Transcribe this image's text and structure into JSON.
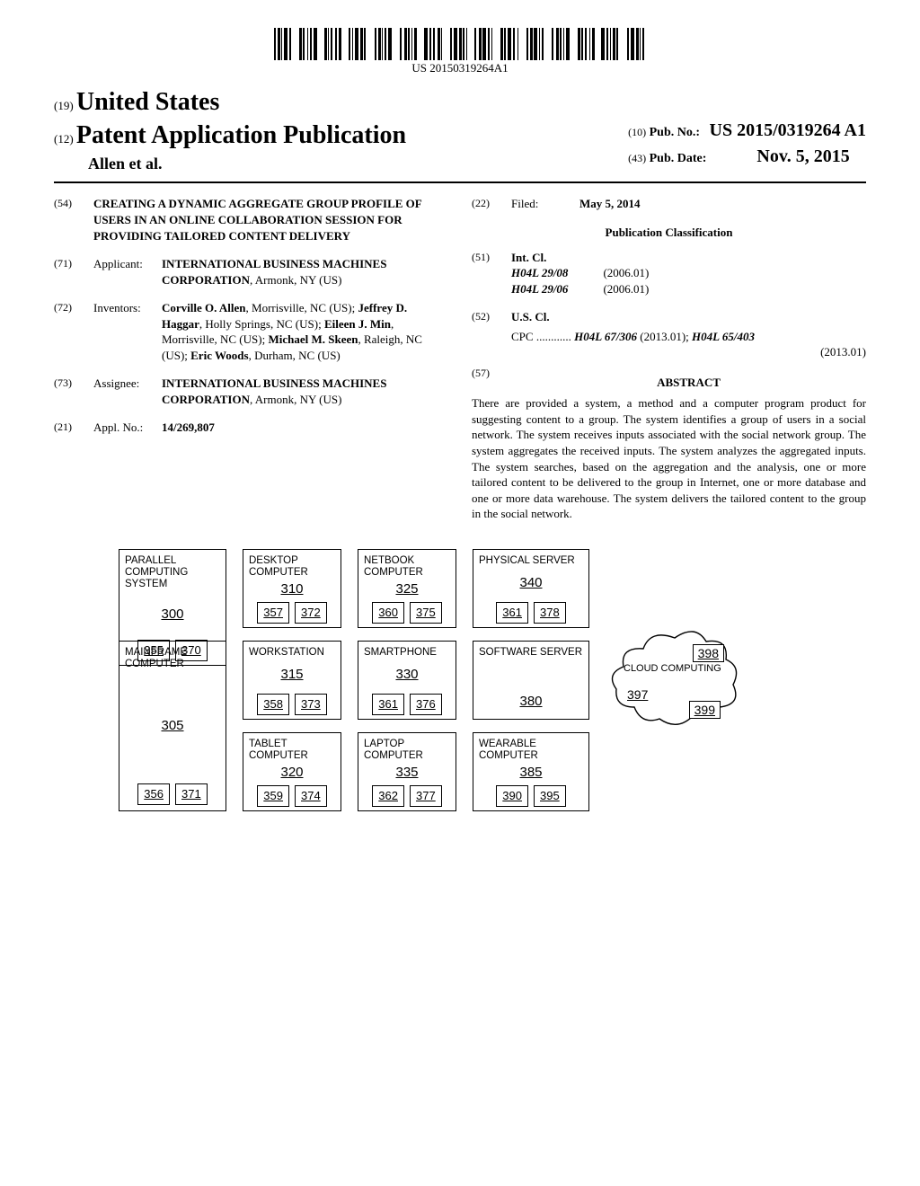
{
  "barcode_text": "US 20150319264A1",
  "header": {
    "prefix_19": "(19)",
    "country": "United States",
    "prefix_12": "(12)",
    "doc_kind": "Patent Application Publication",
    "authors": "Allen et al.",
    "prefix_10": "(10)",
    "pub_no_label": "Pub. No.:",
    "pub_no": "US 2015/0319264 A1",
    "prefix_43": "(43)",
    "pub_date_label": "Pub. Date:",
    "pub_date": "Nov. 5, 2015"
  },
  "left_col": {
    "f54": {
      "num": "(54)",
      "title": "CREATING A DYNAMIC AGGREGATE GROUP PROFILE OF USERS IN AN ONLINE COLLABORATION SESSION FOR PROVIDING TAILORED CONTENT DELIVERY"
    },
    "f71": {
      "num": "(71)",
      "label": "Applicant:",
      "value": "INTERNATIONAL BUSINESS MACHINES CORPORATION",
      "addr": "Armonk, NY (US)"
    },
    "f72": {
      "num": "(72)",
      "label": "Inventors:",
      "value": "Corville O. Allen, Morrisville, NC (US); Jeffrey D. Haggar, Holly Springs, NC (US); Eileen J. Min, Morrisville, NC (US); Michael M. Skeen, Raleigh, NC (US); Eric Woods, Durham, NC (US)"
    },
    "f73": {
      "num": "(73)",
      "label": "Assignee:",
      "value": "INTERNATIONAL BUSINESS MACHINES CORPORATION",
      "addr": "Armonk, NY (US)"
    },
    "f21": {
      "num": "(21)",
      "label": "Appl. No.:",
      "value": "14/269,807"
    }
  },
  "right_col": {
    "f22": {
      "num": "(22)",
      "label": "Filed:",
      "value": "May 5, 2014"
    },
    "pub_class": "Publication Classification",
    "f51": {
      "num": "(51)",
      "label": "Int. Cl.",
      "items": [
        {
          "code": "H04L 29/08",
          "edition": "(2006.01)"
        },
        {
          "code": "H04L 29/06",
          "edition": "(2006.01)"
        }
      ]
    },
    "f52": {
      "num": "(52)",
      "label": "U.S. Cl.",
      "cpc_prefix": "CPC ............",
      "cpc": "H04L 67/306 (2013.01); H04L 65/403 (2013.01)"
    },
    "f57": {
      "num": "(57)",
      "heading": "ABSTRACT",
      "body": "There are provided a system, a method and a computer program product for suggesting content to a group. The system identifies a group of users in a social network. The system receives inputs associated with the social network group. The system aggregates the received inputs. The system analyzes the aggregated inputs. The system searches, based on the aggregation and the analysis, one or more tailored content to be delivered to the group in Internet, one or more database and one or more data warehouse. The system delivers the tailored content to the group in the social network."
    }
  },
  "figure": {
    "parallel": {
      "title": "PARALLEL COMPUTING SYSTEM",
      "ref": "300",
      "p1": "355",
      "p2": "370"
    },
    "mainframe": {
      "title": "MAINFRAME COMPUTER",
      "ref": "305",
      "p1": "356",
      "p2": "371"
    },
    "desktop": {
      "title": "DESKTOP COMPUTER",
      "ref": "310",
      "p1": "357",
      "p2": "372"
    },
    "workstation": {
      "title": "WORKSTATION",
      "ref": "315",
      "p1": "358",
      "p2": "373"
    },
    "tablet": {
      "title": "TABLET COMPUTER",
      "ref": "320",
      "p1": "359",
      "p2": "374"
    },
    "netbook": {
      "title": "NETBOOK COMPUTER",
      "ref": "325",
      "p1": "360",
      "p2": "375"
    },
    "smartphone": {
      "title": "SMARTPHONE",
      "ref": "330",
      "p1": "361",
      "p2": "376"
    },
    "laptop": {
      "title": "LAPTOP COMPUTER",
      "ref": "335",
      "p1": "362",
      "p2": "377"
    },
    "physical": {
      "title": "PHYSICAL SERVER",
      "ref": "340",
      "p1": "361",
      "p2": "378"
    },
    "swserver": {
      "title": "SOFTWARE SERVER",
      "ref": "380"
    },
    "wearable": {
      "title": "WEARABLE COMPUTER",
      "ref": "385",
      "p1": "390",
      "p2": "395"
    },
    "cloud": {
      "title": "CLOUD COMPUTING",
      "ref": "397",
      "n1": "398",
      "n2": "399"
    }
  }
}
